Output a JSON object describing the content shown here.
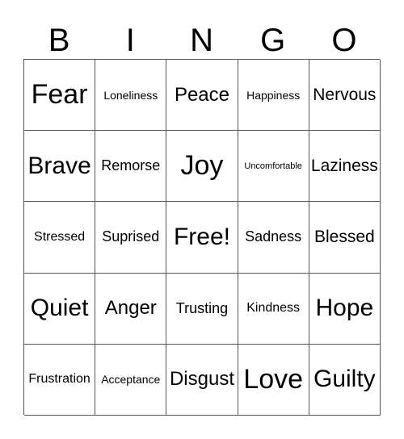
{
  "header": {
    "letters": [
      "B",
      "I",
      "N",
      "G",
      "O"
    ]
  },
  "grid": {
    "rows": [
      [
        "Fear",
        "Loneliness",
        "Peace",
        "Happiness",
        "Nervous"
      ],
      [
        "Brave",
        "Remorse",
        "Joy",
        "Uncomfortable",
        "Laziness"
      ],
      [
        "Stressed",
        "Suprised",
        "Free!",
        "Sadness",
        "Blessed"
      ],
      [
        "Quiet",
        "Anger",
        "Trusting",
        "Kindness",
        "Hope"
      ],
      [
        "Frustration",
        "Acceptance",
        "Disgust",
        "Love",
        "Guilty"
      ]
    ]
  }
}
